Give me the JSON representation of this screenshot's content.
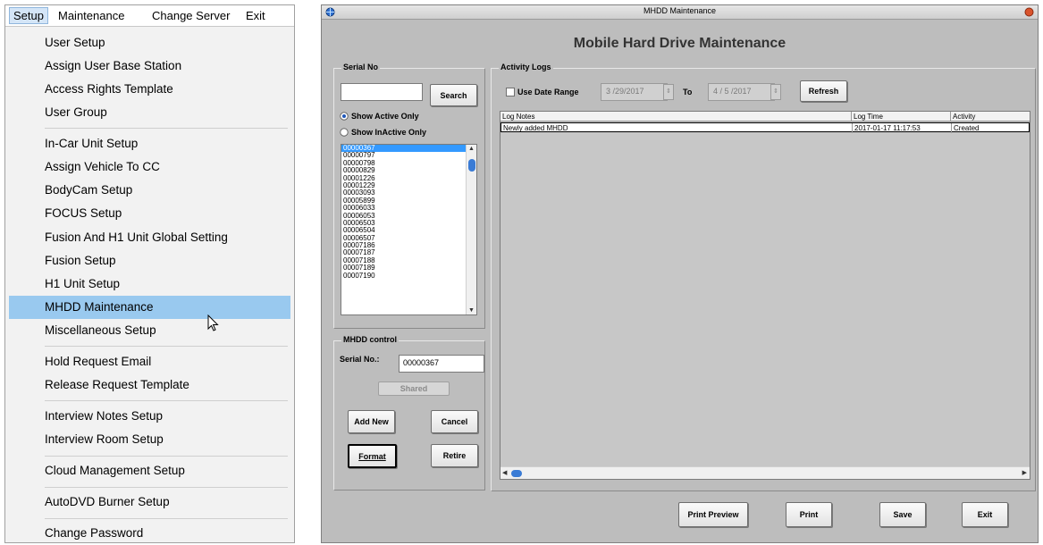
{
  "menu": {
    "bar": [
      "Setup",
      "Maintenance",
      "Change Server",
      "Exit"
    ],
    "items": [
      "User Setup",
      "Assign User Base Station",
      "Access Rights Template",
      "User Group",
      "In-Car Unit Setup",
      "Assign Vehicle To CC",
      "BodyCam Setup",
      "FOCUS Setup",
      "Fusion And H1 Unit Global Setting",
      "Fusion Setup",
      "H1 Unit Setup",
      "MHDD Maintenance",
      "Miscellaneous Setup",
      "Hold Request Email",
      "Release Request Template",
      "Interview Notes Setup",
      "Interview Room Setup",
      "Cloud Management Setup",
      "AutoDVD Burner Setup",
      "Change Password"
    ],
    "selected": "MHDD Maintenance"
  },
  "window": {
    "title": "MHDD Maintenance",
    "heading": "Mobile Hard Drive Maintenance"
  },
  "serial_group": {
    "legend": "Serial No",
    "search_value": "",
    "search_button": "Search",
    "radio_active": "Show Active Only",
    "radio_inactive": "Show InActive Only",
    "selected_filter": "active",
    "serials": [
      "00000367",
      "00000797",
      "00000798",
      "00000829",
      "00001226",
      "00001229",
      "00003093",
      "00005899",
      "00006033",
      "00006053",
      "00006503",
      "00006504",
      "00006507",
      "00007186",
      "00007187",
      "00007188",
      "00007189",
      "00007190"
    ],
    "selected_serial": "00000367"
  },
  "mhdd_control": {
    "legend": "MHDD control",
    "serial_label": "Serial No.:",
    "serial_value": "00000367",
    "shared_button": "Shared",
    "add_new": "Add New",
    "cancel": "Cancel",
    "format": "Format",
    "retire": "Retire"
  },
  "activity": {
    "legend": "Activity Logs",
    "use_date_range": "Use Date Range",
    "date_from": "3 /29/2017",
    "to_label": "To",
    "date_to": "4 / 5 /2017",
    "refresh": "Refresh",
    "columns": [
      "Log Notes",
      "Log Time",
      "Activity"
    ],
    "rows": [
      [
        "Newly added MHDD",
        "2017-01-17 11:17:53",
        "Created"
      ]
    ]
  },
  "bottom_buttons": {
    "print_preview": "Print Preview",
    "print": "Print",
    "save": "Save",
    "exit": "Exit"
  },
  "colors": {
    "selection_highlight": "#99c9ef",
    "window_bg": "#bdbdbd",
    "list_selected": "#3399ff"
  }
}
